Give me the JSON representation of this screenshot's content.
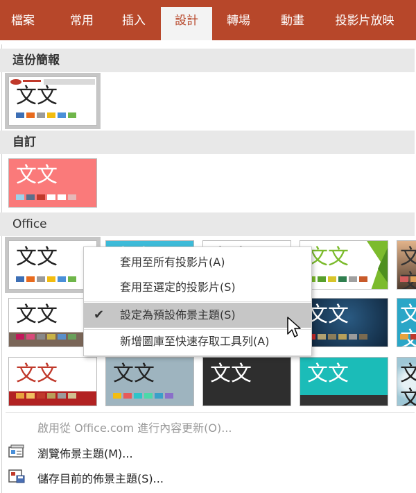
{
  "ribbon": {
    "tabs": [
      {
        "label": "檔案"
      },
      {
        "label": "常用"
      },
      {
        "label": "插入"
      },
      {
        "label": "設計"
      },
      {
        "label": "轉場"
      },
      {
        "label": "動畫"
      },
      {
        "label": "投影片放映"
      }
    ],
    "active_tab": "設計",
    "accent": "#b7472a"
  },
  "sections": {
    "this_presentation": "這份簡報",
    "custom": "自訂",
    "office": "Office"
  },
  "theme_sample_text": "文文",
  "themes": {
    "this_presentation": {
      "swatches": [
        "#3d6fb5",
        "#e86b1e",
        "#9b9b9b",
        "#f3bd10",
        "#4a90d9",
        "#6fb64a"
      ]
    },
    "custom": {
      "swatches": [
        "#9ed2ea",
        "#5a6f8a",
        "#c0392b",
        "#ffffff",
        "#ffffff",
        "#e6b8b8"
      ]
    },
    "office": [
      {
        "swatches": [
          "#3d6fb5",
          "#e86b1e",
          "#9b9b9b",
          "#f3bd10",
          "#4a90d9",
          "#6fb64a"
        ]
      },
      {
        "swatches": [
          "#2aa6c7",
          "#66c2d6",
          "#9b9b9b",
          "#f3bd10",
          "#4a90d9",
          "#6fb64a"
        ]
      },
      {
        "swatches": [
          "#3d6fb5",
          "#e86b1e",
          "#9b9b9b",
          "#f3bd10",
          "#4a90d9",
          "#6fb64a"
        ]
      },
      {
        "swatches": [
          "#7cbb2d",
          "#58a02c",
          "#d8c52a",
          "#2f7f4f",
          "#a0a0a0",
          "#c85a2a"
        ]
      },
      {
        "swatches": [
          "#d45d5d",
          "#e0a15a",
          "#7d7d7d",
          "#c9b347",
          "#5a8fc9",
          "#6aa05a"
        ]
      },
      {
        "swatches": [
          "#c2185b",
          "#d84a7a",
          "#888888",
          "#c9b347",
          "#5a8fc9",
          "#6aa05a"
        ]
      },
      {
        "swatches": [
          "#2ec4c9",
          "#3aa0c9",
          "#4cd9a8",
          "#e85a5a",
          "#f3bd10",
          "#8a6fc9"
        ]
      },
      {
        "swatches": [
          "#2ec4c9",
          "#3aa0c9",
          "#4cd9a8",
          "#e85a5a",
          "#f3bd10",
          "#8a6fc9"
        ]
      },
      {
        "swatches": [
          "#c62828",
          "#b0a070",
          "#8b7d5a",
          "#b8a05a",
          "#9b9b9b",
          "#7a6a50"
        ]
      },
      {
        "swatches": [
          "#e8a33d",
          "#c0392b",
          "#8b7d5a",
          "#b8a05a",
          "#9b9b9b",
          "#7a6a50"
        ]
      },
      {
        "swatches": [
          "#e8a33d",
          "#f0c060",
          "#c0392b",
          "#b8a05a",
          "#9b9b9b",
          "#d0c090"
        ]
      },
      {
        "swatches": [
          "#f3bd10",
          "#e85a5a",
          "#2ec4c9",
          "#4cd9a8",
          "#3aa0c9",
          "#8a6fc9"
        ]
      }
    ]
  },
  "context_menu": {
    "items": [
      {
        "label": "套用至所有投影片(A)",
        "checked": false
      },
      {
        "label": "套用至選定的投影片(S)",
        "checked": false
      },
      {
        "label": "設定為預設佈景主題(S)",
        "checked": true
      },
      {
        "label": "新增圖庫至快速存取工具列(A)",
        "checked": false
      }
    ],
    "check_glyph": "✔"
  },
  "commands": {
    "enable_updates": "啟用從 Office.com 進行內容更新(O)...",
    "browse_themes": "瀏覽佈景主題(M)...",
    "save_theme": "儲存目前的佈景主題(S)..."
  }
}
